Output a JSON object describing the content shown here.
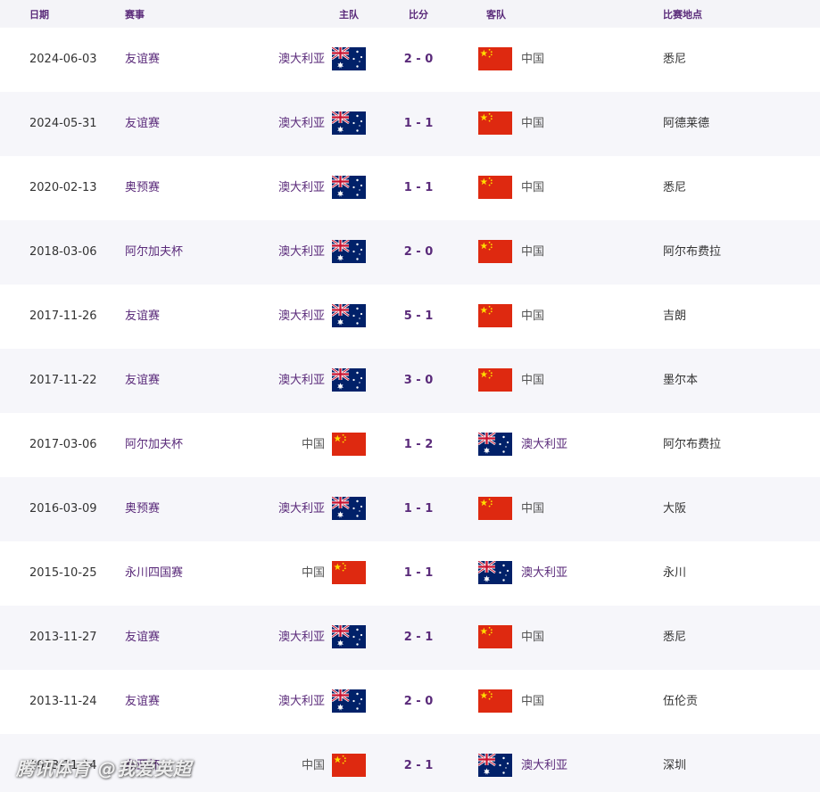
{
  "headers": {
    "date": "日期",
    "event": "赛事",
    "home": "主队",
    "score": "比分",
    "away": "客队",
    "venue": "比赛地点"
  },
  "flags": {
    "australia": "australia-flag-icon",
    "china": "china-flag-icon"
  },
  "colors": {
    "accent": "#5a2a7a",
    "header_bg": "#f4f4f8",
    "row_alt_bg": "#f6f6fa"
  },
  "matches": [
    {
      "date": "2024-06-03",
      "event": "友谊赛",
      "home": "澳大利亚",
      "home_flag": "au",
      "score": "2 - 0",
      "away": "中国",
      "away_flag": "cn",
      "venue": "悉尼"
    },
    {
      "date": "2024-05-31",
      "event": "友谊赛",
      "home": "澳大利亚",
      "home_flag": "au",
      "score": "1 - 1",
      "away": "中国",
      "away_flag": "cn",
      "venue": "阿德莱德"
    },
    {
      "date": "2020-02-13",
      "event": "奥预赛",
      "home": "澳大利亚",
      "home_flag": "au",
      "score": "1 - 1",
      "away": "中国",
      "away_flag": "cn",
      "venue": "悉尼"
    },
    {
      "date": "2018-03-06",
      "event": "阿尔加夫杯",
      "home": "澳大利亚",
      "home_flag": "au",
      "score": "2 - 0",
      "away": "中国",
      "away_flag": "cn",
      "venue": "阿尔布费拉"
    },
    {
      "date": "2017-11-26",
      "event": "友谊赛",
      "home": "澳大利亚",
      "home_flag": "au",
      "score": "5 - 1",
      "away": "中国",
      "away_flag": "cn",
      "venue": "吉朗"
    },
    {
      "date": "2017-11-22",
      "event": "友谊赛",
      "home": "澳大利亚",
      "home_flag": "au",
      "score": "3 - 0",
      "away": "中国",
      "away_flag": "cn",
      "venue": "墨尔本"
    },
    {
      "date": "2017-03-06",
      "event": "阿尔加夫杯",
      "home": "中国",
      "home_flag": "cn",
      "score": "1 - 2",
      "away": "澳大利亚",
      "away_flag": "au",
      "venue": "阿尔布费拉"
    },
    {
      "date": "2016-03-09",
      "event": "奥预赛",
      "home": "澳大利亚",
      "home_flag": "au",
      "score": "1 - 1",
      "away": "中国",
      "away_flag": "cn",
      "venue": "大阪"
    },
    {
      "date": "2015-10-25",
      "event": "永川四国赛",
      "home": "中国",
      "home_flag": "cn",
      "score": "1 - 1",
      "away": "澳大利亚",
      "away_flag": "au",
      "venue": "永川"
    },
    {
      "date": "2013-11-27",
      "event": "友谊赛",
      "home": "澳大利亚",
      "home_flag": "au",
      "score": "2 - 1",
      "away": "中国",
      "away_flag": "cn",
      "venue": "悉尼"
    },
    {
      "date": "2013-11-24",
      "event": "友谊赛",
      "home": "澳大利亚",
      "home_flag": "au",
      "score": "2 - 0",
      "away": "中国",
      "away_flag": "cn",
      "venue": "伍伦贡"
    },
    {
      "date": "2013-11-14",
      "event": "东亚杯",
      "home": "中国",
      "home_flag": "cn",
      "score": "2 - 1",
      "away": "澳大利亚",
      "away_flag": "au",
      "venue": "深圳"
    }
  ],
  "watermark": "腾讯体育 @我爱英超"
}
